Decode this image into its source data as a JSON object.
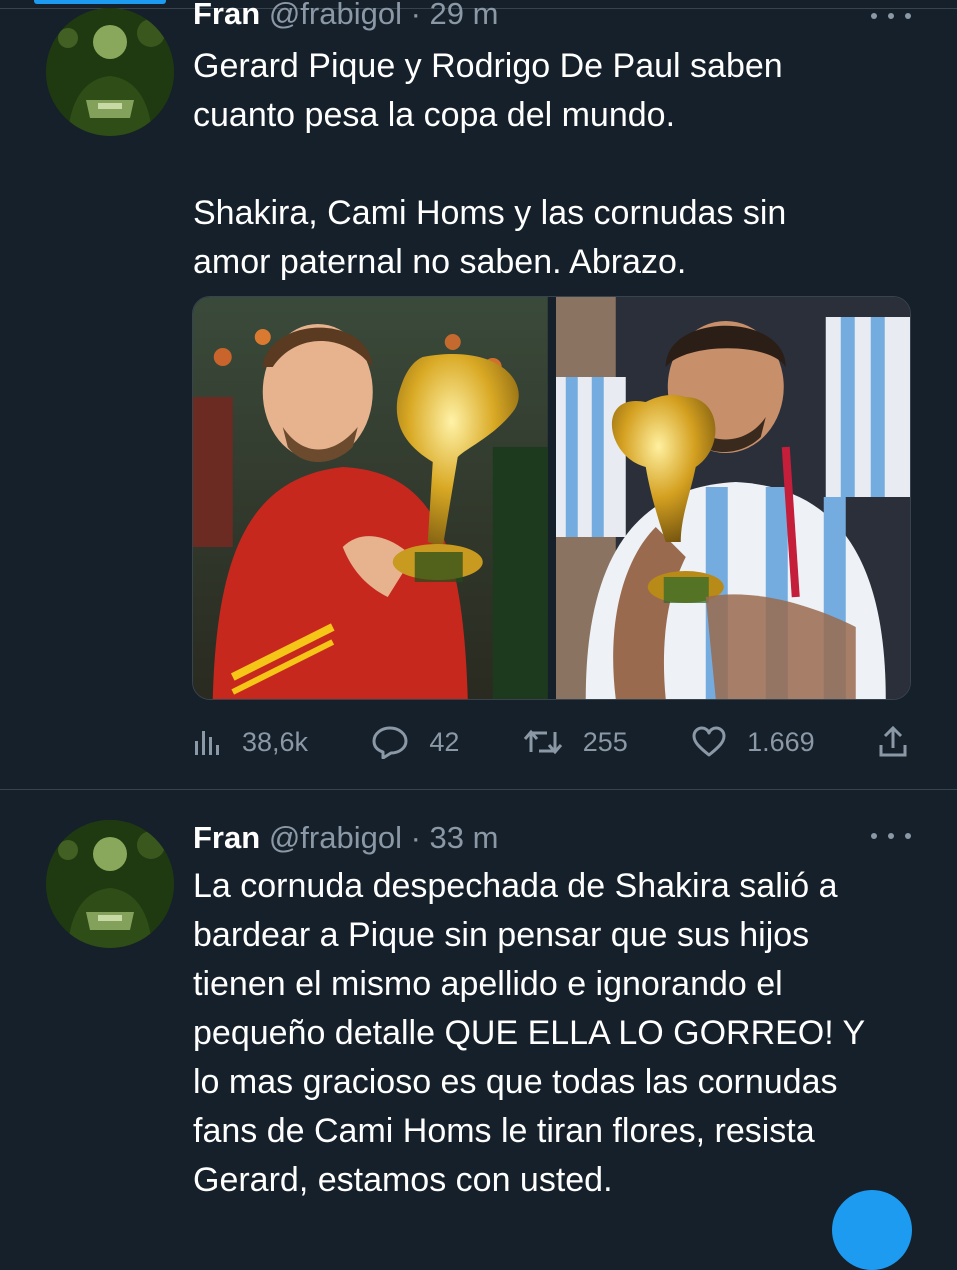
{
  "colors": {
    "background": "#15202b",
    "divider": "#38444d",
    "secondary_text": "#8b98a5",
    "accent": "#1d9bf0"
  },
  "tweets": [
    {
      "name": "Fran",
      "handle": "@frabigol",
      "separator": "·",
      "time": "29 m",
      "text": "Gerard Pique y Rodrigo De Paul saben\ncuanto pesa la copa del mundo.\n\nShakira, Cami Homs y las cornudas sin\namor paternal no saben. Abrazo.",
      "icons": {
        "more": "more-options-icon",
        "views": "views-chart-icon",
        "reply": "reply-icon",
        "retweet": "retweet-icon",
        "like": "heart-icon",
        "share": "share-icon"
      },
      "stats": {
        "views": "38,6k",
        "replies": "42",
        "retweets": "255",
        "likes": "1.669"
      }
    },
    {
      "name": "Fran",
      "handle": "@frabigol",
      "separator": "·",
      "time": "33 m",
      "text": "La cornuda despechada de Shakira salió a\nbardear a Pique sin pensar que sus hijos\ntienen el mismo apellido e ignorando el\npequeño detalle QUE ELLA LO GORREO! Y\nlo mas gracioso es que todas las cornudas\nfans de Cami Homs le tiran flores, resista\nGerard, estamos con usted.",
      "icons": {
        "more": "more-options-icon"
      }
    }
  ]
}
